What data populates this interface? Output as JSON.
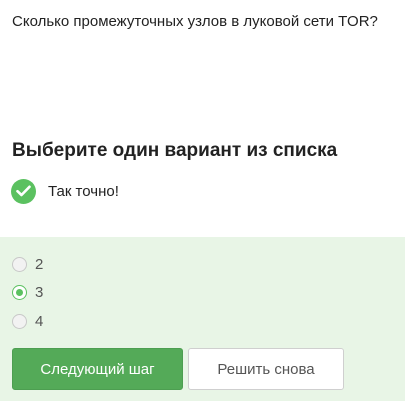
{
  "question": {
    "text": "Сколько промежуточных узлов в луковой сети TOR?"
  },
  "instruction": {
    "heading": "Выберите один вариант из списка"
  },
  "feedback": {
    "icon": "check-icon",
    "text": "Так точно!",
    "color": "#5bc160"
  },
  "options": [
    {
      "label": "2",
      "selected": false
    },
    {
      "label": "3",
      "selected": true
    },
    {
      "label": "4",
      "selected": false
    }
  ],
  "buttons": {
    "next_label": "Следующий шаг",
    "retry_label": "Решить снова"
  },
  "colors": {
    "accent": "#5bc160",
    "primary_button": "#54aa58",
    "panel_background": "#e8f5e6"
  }
}
